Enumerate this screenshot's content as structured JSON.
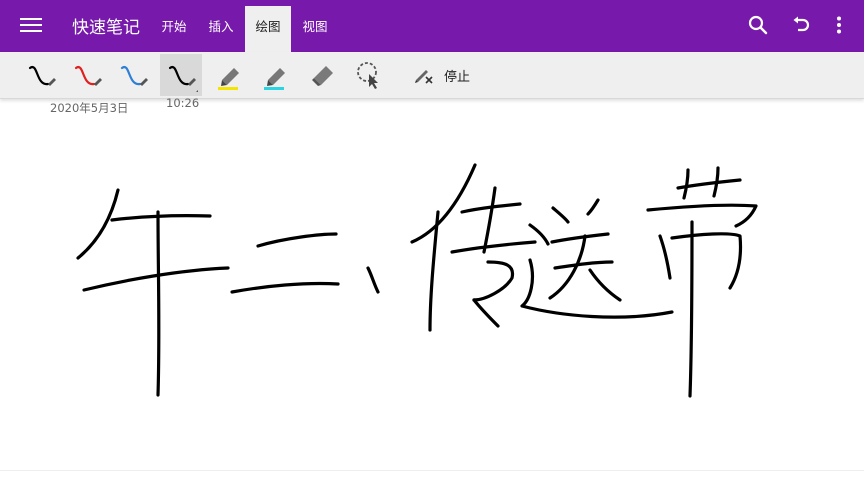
{
  "app": {
    "title": "快速笔记"
  },
  "tabs": [
    {
      "label": "开始"
    },
    {
      "label": "插入"
    },
    {
      "label": "绘图",
      "active": true
    },
    {
      "label": "视图"
    }
  ],
  "header_icons": [
    "menu-icon",
    "search-icon",
    "undo-icon",
    "more-vertical-icon"
  ],
  "toolbar": {
    "tools": [
      {
        "name": "pen-black",
        "color": "#000000"
      },
      {
        "name": "pen-red",
        "color": "#e02020"
      },
      {
        "name": "pen-blue",
        "color": "#2f7fd6"
      },
      {
        "name": "pen-black-selected",
        "color": "#000000",
        "selected": true
      },
      {
        "name": "highlighter-yellow",
        "color": "#f5e400"
      },
      {
        "name": "highlighter-cyan",
        "color": "#2ad4e0"
      },
      {
        "name": "eraser",
        "color": "#777777"
      },
      {
        "name": "lasso-select",
        "color": "#555555"
      }
    ],
    "stop_label": "停止"
  },
  "page": {
    "date": "2020年5月3日",
    "time": "10:26",
    "ink_text": "牛二、传送带"
  },
  "colors": {
    "brand": "#7719aa",
    "toolbar_bg": "#efefef",
    "ink": "#000000"
  }
}
